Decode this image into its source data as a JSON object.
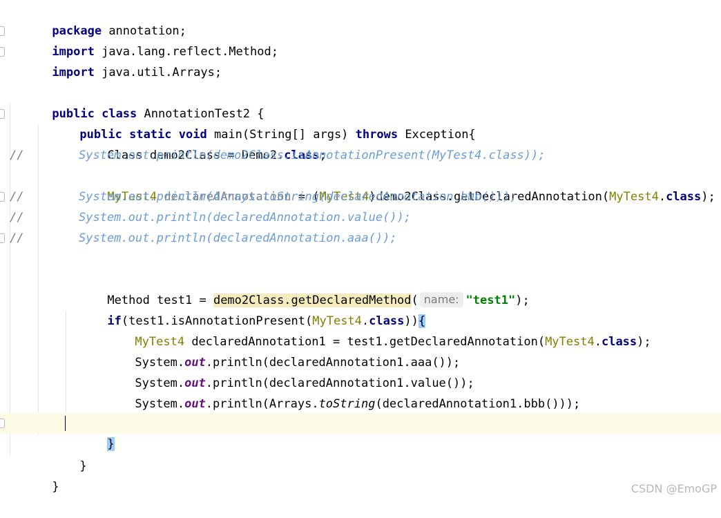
{
  "editor": {
    "lines": {
      "l1": {
        "kw1": "package",
        "rest": " annotation;"
      },
      "l2": {
        "kw1": "import",
        "rest": " java.lang.reflect.Method;"
      },
      "l3": {
        "kw1": "import",
        "rest": " java.util.Arrays;"
      },
      "l5": {
        "kw1": "public",
        "kw2": "class",
        "name": " AnnotationTest2 {"
      },
      "l6": {
        "kw1": "public",
        "kw2": "static",
        "kw3": "void",
        "sig": " main(String[] args) ",
        "kw4": "throws",
        "rest": " Exception{"
      },
      "l7": {
        "pre": "Class demo2Class = Demo2.",
        "kw": "class",
        "post": ";"
      },
      "l8": {
        "slashes": "//",
        "code": "System.out.println(demo2Class.isAnnotationPresent(MyTest4.class));"
      },
      "l9": {
        "type": "MyTest4",
        "var": " declaredAnnotation",
        "eq": " = (",
        "cast": "MyTest4",
        "call": ")demo2Class.getDeclaredAnnotation(",
        "arg": "MyTest4",
        "dot": ".",
        "kw": "class",
        "end": ");"
      },
      "l10": {
        "slashes": "//",
        "code": "System.out.println(Arrays.toString(declaredAnnotation.bbb()));"
      },
      "l11": {
        "slashes": "//",
        "code": "System.out.println(declaredAnnotation.value());"
      },
      "l12": {
        "slashes": "//",
        "code": "System.out.println(declaredAnnotation.aaa());"
      },
      "l14": {
        "pre": "Method test1 = ",
        "hl": "demo2Class.getDeclaredMethod",
        "paren": "(",
        "hint": "name:",
        "str": "\"test1\"",
        "end": ");"
      },
      "l15": {
        "kw": "if",
        "pre": "(test1.isAnnotationPresent(",
        "type": "MyTest4",
        "dot": ".",
        "kw2": "class",
        "close": "))",
        "brace": "{"
      },
      "l16": {
        "type": "MyTest4",
        "pre": " declaredAnnotation1 = test1.getDeclaredAnnotation(",
        "arg": "MyTest4",
        "dot": ".",
        "kw": "class",
        "end": ");"
      },
      "l17": {
        "pre": "System.",
        "field": "out",
        "post": ".println(declaredAnnotation1.aaa());"
      },
      "l18": {
        "pre": "System.",
        "field": "out",
        "post": ".println(declaredAnnotation1.value());"
      },
      "l19": {
        "pre": "System.",
        "field": "out",
        "mid": ".println(Arrays.",
        "method": "toString",
        "post": "(declaredAnnotation1.bbb()));"
      },
      "l21": {
        "brace": "}"
      },
      "l22": {
        "brace": "}"
      },
      "l23": {
        "brace": "}"
      }
    },
    "colors": {
      "keyword": "#000080",
      "class_highlight": "#808000",
      "string": "#008000",
      "comment": "#808080",
      "commented_code": "#6a9dd8",
      "static_field": "#660e7a",
      "usage_highlight": "#f6ebbc",
      "brace_match": "#99ccff",
      "current_line": "#fdfae6"
    }
  },
  "watermark": "CSDN @EmoGP"
}
